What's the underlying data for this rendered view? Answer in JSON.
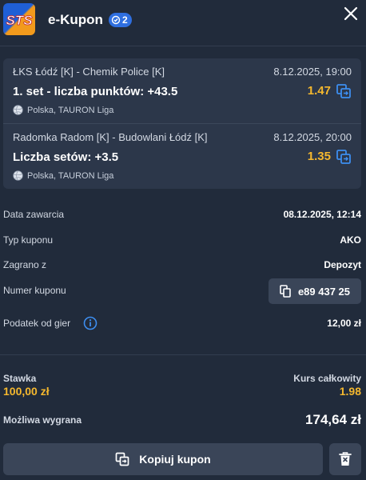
{
  "header": {
    "title": "e-Kupon",
    "coupon_count": "2",
    "logo_text": "STS"
  },
  "bets": [
    {
      "match": "ŁKS Łódź [K] - Chemik Police [K]",
      "datetime": "8.12.2025, 19:00",
      "market": "1. set - liczba punktów: +43.5",
      "odds": "1.47",
      "league": "Polska, TAURON Liga"
    },
    {
      "match": "Radomka Radom [K] - Budowlani Łódź [K]",
      "datetime": "8.12.2025, 20:00",
      "market": "Liczba setów: +3.5",
      "odds": "1.35",
      "league": "Polska, TAURON Liga"
    }
  ],
  "details": {
    "date_label": "Data zawarcia",
    "date_value": "08.12.2025, 12:14",
    "type_label": "Typ kuponu",
    "type_value": "AKO",
    "played_label": "Zagrano z",
    "played_value": "Depozyt",
    "number_label": "Numer kuponu",
    "number_value": "e89 437 25",
    "tax_label": "Podatek od gier",
    "tax_value": "12,00 zł"
  },
  "summary": {
    "stake_label": "Stawka",
    "stake_value": "100,00 zł",
    "total_odds_label": "Kurs całkowity",
    "total_odds_value": "1.98",
    "win_label": "Możliwa wygrana",
    "win_value": "174,64 zł"
  },
  "actions": {
    "copy_label": "Kopiuj kupon"
  },
  "colors": {
    "background": "#212b3b",
    "card": "#2c374a",
    "button": "#3a4558",
    "accent_odds": "#f5b82e",
    "badge": "#2f6fe0"
  }
}
